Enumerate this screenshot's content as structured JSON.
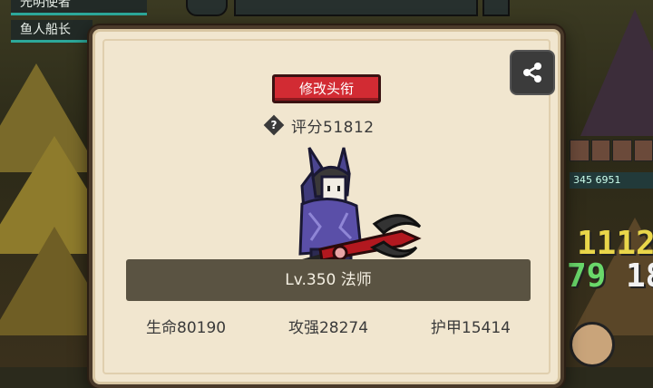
{
  "background": {
    "top_chips": [
      "光明使者",
      "鱼人船长"
    ],
    "side_bar_text": "345  6951",
    "numbers": [
      "1112",
      "79",
      "18"
    ]
  },
  "modal": {
    "edit_title_label": "修改头衔",
    "help_glyph": "?",
    "rating_label": "评分51812",
    "level_class_label": "Lv.350 法师",
    "stats": [
      {
        "label": "生命80190"
      },
      {
        "label": "攻强28274"
      },
      {
        "label": "护甲15414"
      }
    ],
    "share_icon": "share-icon"
  },
  "colors": {
    "modal_bg": "#f1e6cf",
    "button_red": "#d22b33",
    "name_bar": "#5a5342"
  }
}
